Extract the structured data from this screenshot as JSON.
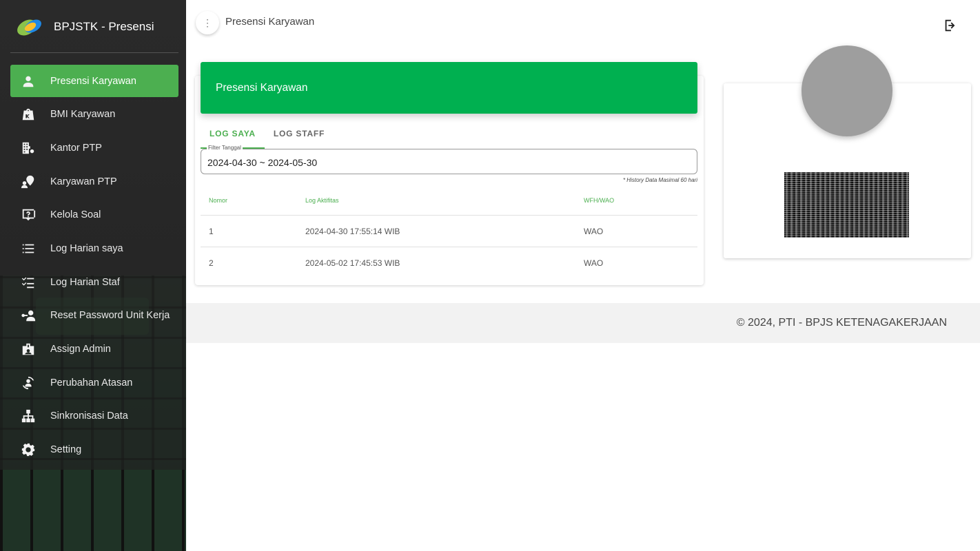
{
  "app": {
    "title": "BPJSTK - Presensi"
  },
  "sidebar": {
    "items": [
      {
        "label": "Presensi Karyawan",
        "icon": "person-icon",
        "active": true
      },
      {
        "label": "BMI Karyawan",
        "icon": "scale-icon"
      },
      {
        "label": "Kantor PTP",
        "icon": "office-building-icon"
      },
      {
        "label": "Karyawan PTP",
        "icon": "employee-location-icon"
      },
      {
        "label": "Kelola Soal",
        "icon": "question-box-icon"
      },
      {
        "label": "Log Harian saya",
        "icon": "list-icon"
      },
      {
        "label": "Log Harian Staf",
        "icon": "checklist-icon"
      },
      {
        "label": "Reset Password Unit Kerja",
        "icon": "key-person-icon"
      },
      {
        "label": "Assign Admin",
        "icon": "badge-icon"
      },
      {
        "label": "Perubahan Atasan",
        "icon": "person-sync-icon"
      },
      {
        "label": "Sinkronisasi Data",
        "icon": "sitemap-icon"
      },
      {
        "label": "Setting",
        "icon": "gear-icon"
      }
    ]
  },
  "topbar": {
    "menu_icon": "⋮",
    "title": "Presensi Karyawan"
  },
  "card": {
    "header": "Presensi Karyawan",
    "tabs": [
      {
        "label": "LOG SAYA",
        "active": true
      },
      {
        "label": "LOG STAFF",
        "active": false
      }
    ],
    "filter": {
      "label": "Filter Tanggal",
      "value": "2024-04-30 ~ 2024-05-30"
    },
    "history_note": "* History Data Masimal 60 hari",
    "table": {
      "headers": [
        "Nomor",
        "Log Aktifitas",
        "WFH/WAO"
      ],
      "rows": [
        [
          "1",
          "2024-04-30 17:55:14 WIB",
          "WAO"
        ],
        [
          "2",
          "2024-05-02 17:45:53 WIB",
          "WAO"
        ]
      ]
    }
  },
  "footer": {
    "text": "© 2024, PTI - BPJS KETENAGAKERJAAN"
  },
  "colors": {
    "accent_green": "#4caf50",
    "header_green": "#00b050",
    "sidebar_bg": "#232323"
  }
}
